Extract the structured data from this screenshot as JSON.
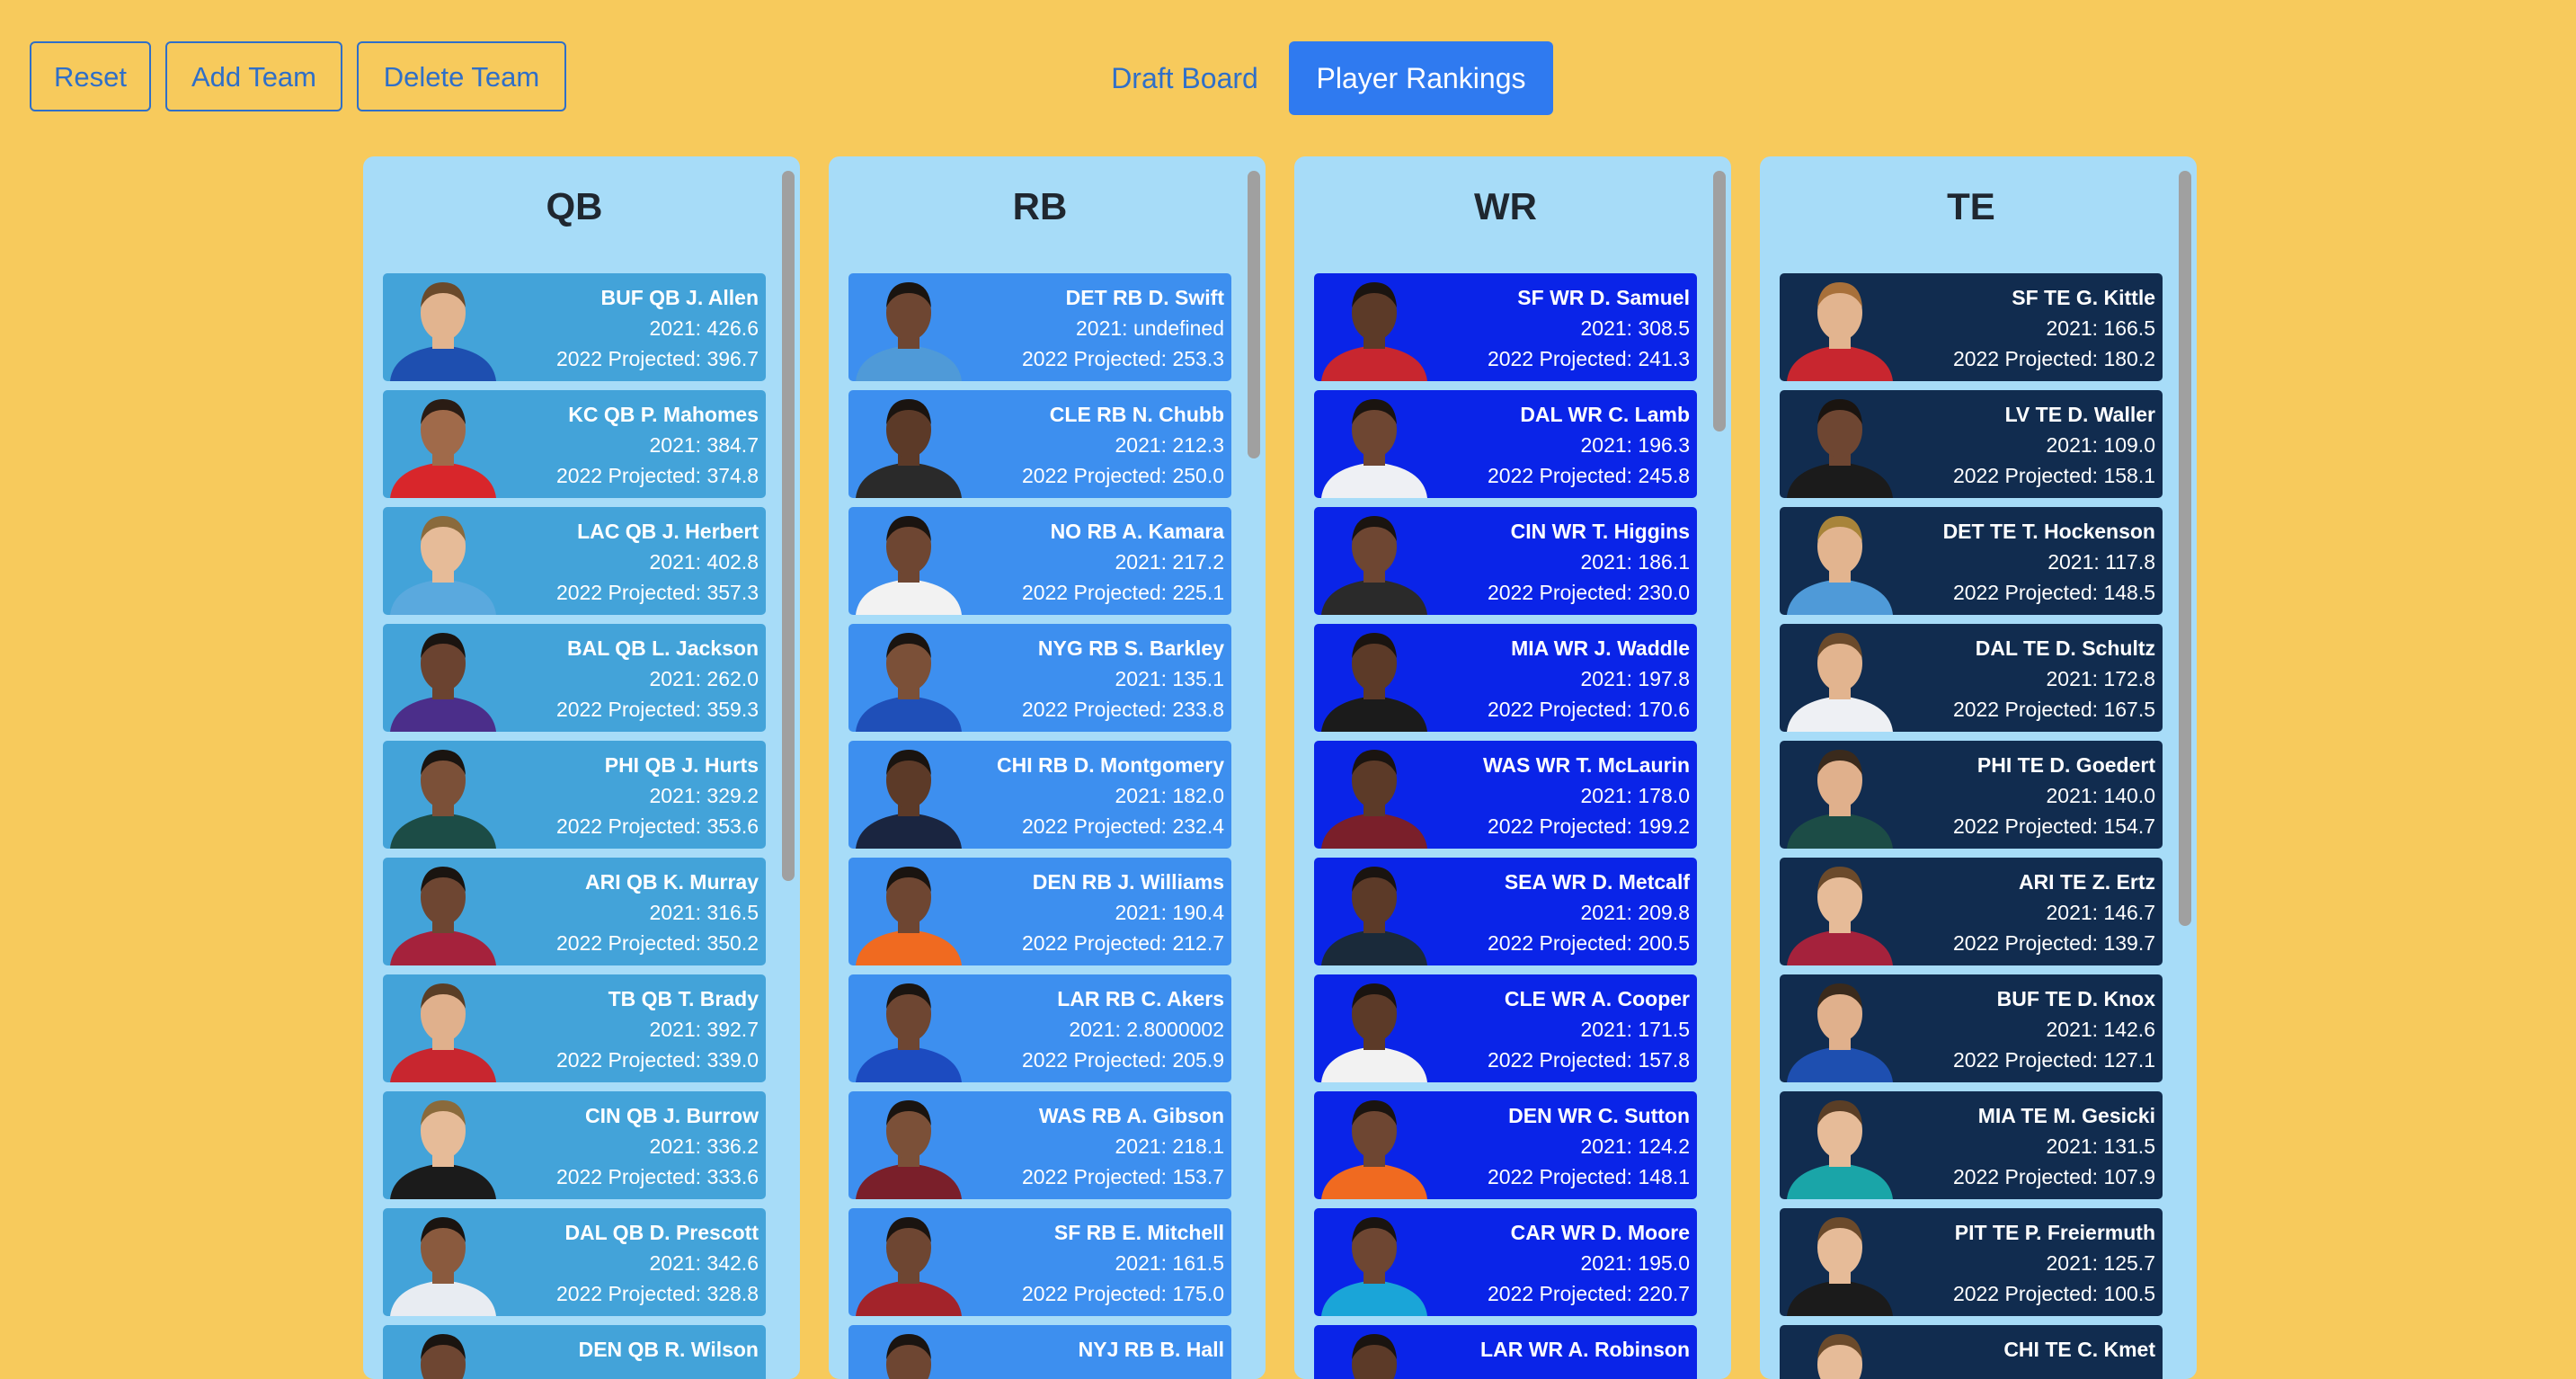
{
  "toolbar": {
    "reset_label": "Reset",
    "add_team_label": "Add Team",
    "delete_team_label": "Delete Team",
    "draft_board_label": "Draft Board",
    "player_rankings_label": "Player Rankings"
  },
  "colors": {
    "background": "#f7ca5c",
    "column_bg": "#a7dcf8",
    "qb_card": "#43a3d9",
    "rb_card": "#3d8fef",
    "wr_card": "#0a24e8",
    "te_card": "#112c4f",
    "accent": "#2f7af0"
  },
  "columns": [
    {
      "id": "qb",
      "title": "QB",
      "players": [
        {
          "name": "BUF QB J. Allen",
          "y2021": "2021: 426.6",
          "proj": "2022 Projected: 396.7",
          "jersey": "#1e4fb0",
          "skin": "#e2b48f",
          "hair": "#6b4a2b"
        },
        {
          "name": "KC QB P. Mahomes",
          "y2021": "2021: 384.7",
          "proj": "2022 Projected: 374.8",
          "jersey": "#d8262b",
          "skin": "#a06a4a",
          "hair": "#2a1c14"
        },
        {
          "name": "LAC QB J. Herbert",
          "y2021": "2021: 402.8",
          "proj": "2022 Projected: 357.3",
          "jersey": "#5aa9de",
          "skin": "#e6bb98",
          "hair": "#8a6a3c"
        },
        {
          "name": "BAL QB L. Jackson",
          "y2021": "2021: 262.0",
          "proj": "2022 Projected: 359.3",
          "jersey": "#4b2e8a",
          "skin": "#6b4330",
          "hair": "#1a1410"
        },
        {
          "name": "PHI QB J. Hurts",
          "y2021": "2021: 329.2",
          "proj": "2022 Projected: 353.6",
          "jersey": "#1c4c46",
          "skin": "#7b5038",
          "hair": "#1a1410"
        },
        {
          "name": "ARI QB K. Murray",
          "y2021": "2021: 316.5",
          "proj": "2022 Projected: 350.2",
          "jersey": "#a5223c",
          "skin": "#6e4632",
          "hair": "#1a1410"
        },
        {
          "name": "TB QB T. Brady",
          "y2021": "2021: 392.7",
          "proj": "2022 Projected: 339.0",
          "jersey": "#c8262f",
          "skin": "#e0b08c",
          "hair": "#5a3e26"
        },
        {
          "name": "CIN QB J. Burrow",
          "y2021": "2021: 336.2",
          "proj": "2022 Projected: 333.6",
          "jersey": "#1b1b1b",
          "skin": "#e6bb98",
          "hair": "#8a6a3c"
        },
        {
          "name": "DAL QB D. Prescott",
          "y2021": "2021: 342.6",
          "proj": "2022 Projected: 328.8",
          "jersey": "#e8ecf2",
          "skin": "#8a5a3e",
          "hair": "#1a1410"
        },
        {
          "name": "DEN QB R. Wilson",
          "y2021": "",
          "proj": "",
          "jersey": "#f06a20",
          "skin": "#6e4632",
          "hair": "#1a1410"
        }
      ]
    },
    {
      "id": "rb",
      "title": "RB",
      "players": [
        {
          "name": "DET RB D. Swift",
          "y2021": "2021: undefined",
          "proj": "2022 Projected: 253.3",
          "jersey": "#4f9ad8",
          "skin": "#6e4632",
          "hair": "#1a1410"
        },
        {
          "name": "CLE RB N. Chubb",
          "y2021": "2021: 212.3",
          "proj": "2022 Projected: 250.0",
          "jersey": "#2a2a2a",
          "skin": "#5c3a28",
          "hair": "#1a1410"
        },
        {
          "name": "NO RB A. Kamara",
          "y2021": "2021: 217.2",
          "proj": "2022 Projected: 225.1",
          "jersey": "#f2f2f2",
          "skin": "#6e4632",
          "hair": "#1a1410"
        },
        {
          "name": "NYG RB S. Barkley",
          "y2021": "2021: 135.1",
          "proj": "2022 Projected: 233.8",
          "jersey": "#1f4fb8",
          "skin": "#7b5038",
          "hair": "#1a1410"
        },
        {
          "name": "CHI RB D. Montgomery",
          "y2021": "2021: 182.0",
          "proj": "2022 Projected: 232.4",
          "jersey": "#1a2540",
          "skin": "#5c3a28",
          "hair": "#1a1410"
        },
        {
          "name": "DEN RB J. Williams",
          "y2021": "2021: 190.4",
          "proj": "2022 Projected: 212.7",
          "jersey": "#f06a20",
          "skin": "#6e4632",
          "hair": "#1a1410"
        },
        {
          "name": "LAR RB C. Akers",
          "y2021": "2021: 2.8000002",
          "proj": "2022 Projected: 205.9",
          "jersey": "#1c4bc0",
          "skin": "#6e4632",
          "hair": "#1a1410"
        },
        {
          "name": "WAS RB A. Gibson",
          "y2021": "2021: 218.1",
          "proj": "2022 Projected: 153.7",
          "jersey": "#7a1f2a",
          "skin": "#7b5038",
          "hair": "#1a1410"
        },
        {
          "name": "SF RB E. Mitchell",
          "y2021": "2021: 161.5",
          "proj": "2022 Projected: 175.0",
          "jersey": "#a3232a",
          "skin": "#6e4632",
          "hair": "#1a1410"
        },
        {
          "name": "NYJ RB B. Hall",
          "y2021": "",
          "proj": "",
          "jersey": "#1f5a3a",
          "skin": "#6e4632",
          "hair": "#1a1410"
        }
      ]
    },
    {
      "id": "wr",
      "title": "WR",
      "players": [
        {
          "name": "SF WR D. Samuel",
          "y2021": "2021: 308.5",
          "proj": "2022 Projected: 241.3",
          "jersey": "#c8262f",
          "skin": "#5c3a28",
          "hair": "#1a1410"
        },
        {
          "name": "DAL WR C. Lamb",
          "y2021": "2021: 196.3",
          "proj": "2022 Projected: 245.8",
          "jersey": "#eef0f4",
          "skin": "#6e4632",
          "hair": "#1a1410"
        },
        {
          "name": "CIN WR T. Higgins",
          "y2021": "2021: 186.1",
          "proj": "2022 Projected: 230.0",
          "jersey": "#2a2a2a",
          "skin": "#6e4632",
          "hair": "#1a1410"
        },
        {
          "name": "MIA WR J. Waddle",
          "y2021": "2021: 197.8",
          "proj": "2022 Projected: 170.6",
          "jersey": "#1b1b1b",
          "skin": "#5c3a28",
          "hair": "#1a1410"
        },
        {
          "name": "WAS WR T. McLaurin",
          "y2021": "2021: 178.0",
          "proj": "2022 Projected: 199.2",
          "jersey": "#7a1f2a",
          "skin": "#5c3a28",
          "hair": "#1a1410"
        },
        {
          "name": "SEA WR D. Metcalf",
          "y2021": "2021: 209.8",
          "proj": "2022 Projected: 200.5",
          "jersey": "#1a2a3a",
          "skin": "#5c3a28",
          "hair": "#1a1410"
        },
        {
          "name": "CLE WR A. Cooper",
          "y2021": "2021: 171.5",
          "proj": "2022 Projected: 157.8",
          "jersey": "#f2f2f2",
          "skin": "#5c3a28",
          "hair": "#1a1410"
        },
        {
          "name": "DEN WR C. Sutton",
          "y2021": "2021: 124.2",
          "proj": "2022 Projected: 148.1",
          "jersey": "#f06a20",
          "skin": "#6e4632",
          "hair": "#1a1410"
        },
        {
          "name": "CAR WR D. Moore",
          "y2021": "2021: 195.0",
          "proj": "2022 Projected: 220.7",
          "jersey": "#1aa5d8",
          "skin": "#6e4632",
          "hair": "#1a1410"
        },
        {
          "name": "LAR WR A. Robinson",
          "y2021": "",
          "proj": "",
          "jersey": "#1c4bc0",
          "skin": "#5c3a28",
          "hair": "#1a1410"
        }
      ]
    },
    {
      "id": "te",
      "title": "TE",
      "players": [
        {
          "name": "SF TE G. Kittle",
          "y2021": "2021: 166.5",
          "proj": "2022 Projected: 180.2",
          "jersey": "#c8262f",
          "skin": "#e2b48f",
          "hair": "#a8703a"
        },
        {
          "name": "LV TE D. Waller",
          "y2021": "2021: 109.0",
          "proj": "2022 Projected: 158.1",
          "jersey": "#1b1b1b",
          "skin": "#6e4632",
          "hair": "#1a1410"
        },
        {
          "name": "DET TE T. Hockenson",
          "y2021": "2021: 117.8",
          "proj": "2022 Projected: 148.5",
          "jersey": "#4f9ad8",
          "skin": "#e2b48f",
          "hair": "#a8843a"
        },
        {
          "name": "DAL TE D. Schultz",
          "y2021": "2021: 172.8",
          "proj": "2022 Projected: 167.5",
          "jersey": "#eef0f4",
          "skin": "#e2b48f",
          "hair": "#6b4a2b"
        },
        {
          "name": "PHI TE D. Goedert",
          "y2021": "2021: 140.0",
          "proj": "2022 Projected: 154.7",
          "jersey": "#1c4c46",
          "skin": "#e0b08c",
          "hair": "#3a2a1c"
        },
        {
          "name": "ARI TE Z. Ertz",
          "y2021": "2021: 146.7",
          "proj": "2022 Projected: 139.7",
          "jersey": "#a5223c",
          "skin": "#e6bb98",
          "hair": "#6b4a2b"
        },
        {
          "name": "BUF TE D. Knox",
          "y2021": "2021: 142.6",
          "proj": "2022 Projected: 127.1",
          "jersey": "#1e4fb0",
          "skin": "#e0b08c",
          "hair": "#3a2a1c"
        },
        {
          "name": "MIA TE M. Gesicki",
          "y2021": "2021: 131.5",
          "proj": "2022 Projected: 107.9",
          "jersey": "#1aa5a8",
          "skin": "#e6bb98",
          "hair": "#5a3e26"
        },
        {
          "name": "PIT TE P. Freiermuth",
          "y2021": "2021: 125.7",
          "proj": "2022 Projected: 100.5",
          "jersey": "#1b1b1b",
          "skin": "#e6bb98",
          "hair": "#6b4a2b"
        },
        {
          "name": "CHI TE C. Kmet",
          "y2021": "",
          "proj": "",
          "jersey": "#1a2540",
          "skin": "#e6bb98",
          "hair": "#6b4a2b"
        }
      ]
    }
  ]
}
